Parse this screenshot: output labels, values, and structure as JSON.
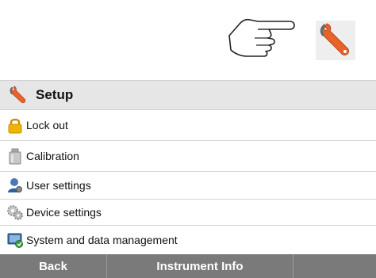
{
  "illustration": {
    "hand_icon": "pointing-hand-icon",
    "wrench_icon": "wrench-icon"
  },
  "menu": {
    "title": "Setup",
    "title_icon": "wrench-icon",
    "items": [
      {
        "label": "Lock out",
        "icon": "padlock-icon"
      },
      {
        "label": "Calibration",
        "icon": "calibration-weight-icon"
      },
      {
        "label": "User settings",
        "icon": "user-settings-icon"
      },
      {
        "label": "Device settings",
        "icon": "gears-icon"
      },
      {
        "label": "System and data management",
        "icon": "system-management-icon"
      }
    ]
  },
  "bottom_bar": {
    "back_label": "Back",
    "info_label": "Instrument Info",
    "third_label": ""
  },
  "colors": {
    "wrench_orange": "#e8622a",
    "wrench_gray": "#5a6b7a",
    "header_bg": "#e6e6e6",
    "bar_bg": "#7a7a7a",
    "lock_gold": "#f0b400"
  }
}
